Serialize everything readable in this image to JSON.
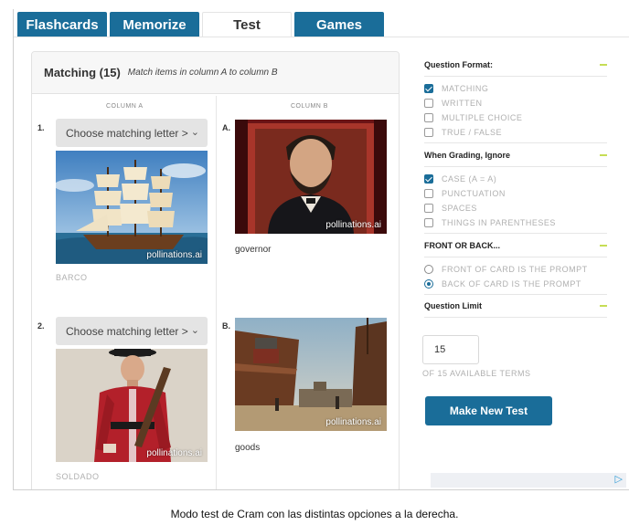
{
  "tabs": [
    {
      "label": "Flashcards",
      "active": false
    },
    {
      "label": "Memorize",
      "active": false
    },
    {
      "label": "Test",
      "active": true
    },
    {
      "label": "Games",
      "active": false
    }
  ],
  "matching": {
    "title": "Matching (15)",
    "subtitle": "Match items in column A to column B",
    "column_a_label": "COLUMN A",
    "column_b_label": "COLUMN B",
    "items_a": [
      {
        "number": "1.",
        "select_value": "Choose matching letter >",
        "image_icon": "sailing-ship-image",
        "watermark": "pollinations.ai",
        "word": "BARCO"
      },
      {
        "number": "2.",
        "select_value": "Choose matching letter >",
        "image_icon": "soldier-image",
        "watermark": "pollinations.ai",
        "word": "SOLDADO"
      }
    ],
    "items_b": [
      {
        "letter": "A.",
        "image_icon": "governor-portrait-image",
        "watermark": "pollinations.ai",
        "word": "governor"
      },
      {
        "letter": "B.",
        "image_icon": "cargo-dock-image",
        "watermark": "pollinations.ai",
        "word": "goods"
      }
    ]
  },
  "options": {
    "question_format": {
      "title": "Question Format:",
      "items": [
        {
          "label": "MATCHING",
          "checked": true
        },
        {
          "label": "WRITTEN",
          "checked": false
        },
        {
          "label": "MULTIPLE CHOICE",
          "checked": false
        },
        {
          "label": "TRUE / FALSE",
          "checked": false
        }
      ]
    },
    "grading": {
      "title": "When Grading, Ignore",
      "items": [
        {
          "label": "CASE (A = A)",
          "checked": true
        },
        {
          "label": "PUNCTUATION",
          "checked": false
        },
        {
          "label": "SPACES",
          "checked": false
        },
        {
          "label": "THINGS IN PARENTHESES",
          "checked": false
        }
      ]
    },
    "front_back": {
      "title": "FRONT OR BACK...",
      "items": [
        {
          "label": "FRONT OF CARD IS THE PROMPT",
          "selected": false
        },
        {
          "label": "BACK OF CARD IS THE PROMPT",
          "selected": true
        }
      ]
    },
    "limit": {
      "title": "Question Limit",
      "value": "15",
      "available": "OF 15 AVAILABLE TERMS"
    },
    "make_button": "Make New Test"
  },
  "caption": "Modo test de Cram con las distintas opciones a la derecha.",
  "colors": {
    "accent": "#1a6d99",
    "collapse": "#c6dd55",
    "muted": "#b0b0b0"
  }
}
